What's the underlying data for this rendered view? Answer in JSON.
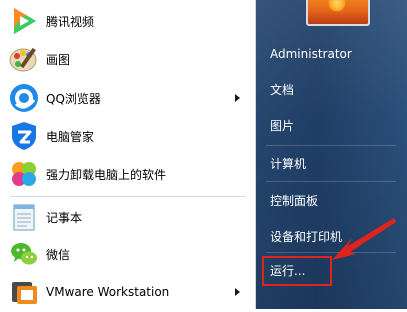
{
  "programs": [
    {
      "label": "腾讯视频",
      "icon": "tencent-video-icon",
      "has_submenu": false
    },
    {
      "label": "画图",
      "icon": "paint-icon",
      "has_submenu": false
    },
    {
      "label": "QQ浏览器",
      "icon": "qq-browser-icon",
      "has_submenu": true
    },
    {
      "label": "电脑管家",
      "icon": "pc-manager-icon",
      "has_submenu": false
    },
    {
      "label": "强力卸载电脑上的软件",
      "icon": "uninstaller-icon",
      "has_submenu": false
    },
    {
      "label": "记事本",
      "icon": "notepad-icon",
      "has_submenu": false
    },
    {
      "label": "微信",
      "icon": "wechat-icon",
      "has_submenu": false
    },
    {
      "label": "VMware Workstation",
      "icon": "vmware-icon",
      "has_submenu": true
    }
  ],
  "right_items": {
    "user": "Administrator",
    "documents": "文档",
    "pictures": "图片",
    "computer": "计算机",
    "control_panel": "控制面板",
    "devices_printers": "设备和打印机",
    "run": "运行..."
  },
  "colors": {
    "right_pane": "#25466e",
    "highlight": "#e0231e"
  }
}
